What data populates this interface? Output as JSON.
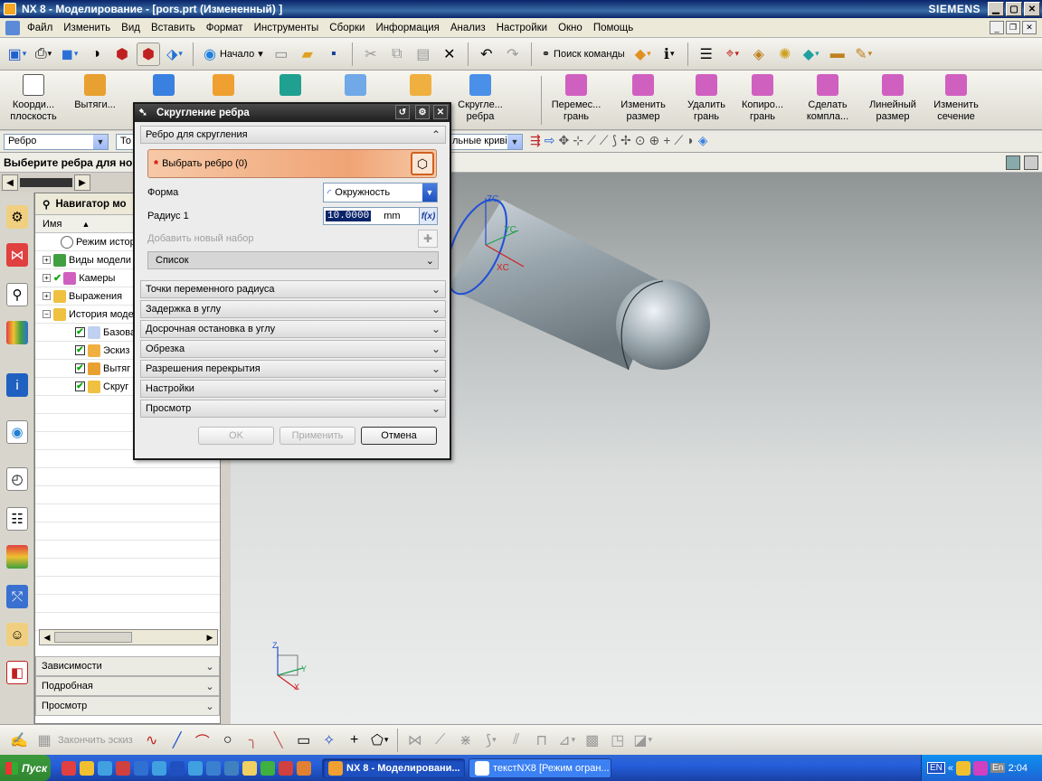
{
  "window": {
    "title": "NX 8 - Моделирование - [pors.prt (Измененный) ]",
    "brand": "SIEMENS"
  },
  "menu": [
    "Файл",
    "Изменить",
    "Вид",
    "Вставить",
    "Формат",
    "Инструменты",
    "Сборки",
    "Информация",
    "Анализ",
    "Настройки",
    "Окно",
    "Помощь"
  ],
  "toolbar1": {
    "start_label": "Начало",
    "search_label": "Поиск команды"
  },
  "toolbar2": [
    {
      "label": "Коорди... плоскость",
      "icon": "datum-plane-icon"
    },
    {
      "label": "Вытяги...",
      "icon": "extrude-icon"
    },
    {
      "label": "",
      "icon": "solid-icon"
    },
    {
      "label": "",
      "icon": "pattern-icon"
    },
    {
      "label": "",
      "icon": "feature-icon"
    },
    {
      "label": "",
      "icon": "box-icon"
    },
    {
      "label": "",
      "icon": "block-icon"
    },
    {
      "label": "Скругле... ребра",
      "icon": "edge-blend-icon"
    },
    {
      "label": "Перемес... грань",
      "icon": "move-face-icon"
    },
    {
      "label": "Изменить размер",
      "icon": "resize-icon"
    },
    {
      "label": "Удалить грань",
      "icon": "delete-face-icon"
    },
    {
      "label": "Копиро... грань",
      "icon": "copy-face-icon"
    },
    {
      "label": "Сделать компла...",
      "icon": "coplanar-icon"
    },
    {
      "label": "Линейный размер",
      "icon": "linear-dim-icon"
    },
    {
      "label": "Изменить сечение",
      "icon": "section-icon"
    }
  ],
  "toolbar3": {
    "filter_value": "Ребро",
    "scope_value": "То",
    "curve_rule": "льные криві"
  },
  "cue_line": "Выберите ребра для нов",
  "navigator": {
    "title": "Навигатор мо",
    "column_name": "Имя",
    "items": [
      {
        "label": "Режим истор",
        "level": 0
      },
      {
        "label": "Виды модели",
        "level": 0
      },
      {
        "label": "Камеры",
        "level": 0
      },
      {
        "label": "Выражения",
        "level": 0
      },
      {
        "label": "История моде",
        "level": 0
      },
      {
        "label": "Базова",
        "level": 1
      },
      {
        "label": "Эскиз",
        "level": 1
      },
      {
        "label": "Вытяг",
        "level": 1
      },
      {
        "label": "Скруг",
        "level": 1
      }
    ],
    "panels": [
      "Зависимости",
      "Подробная",
      "Просмотр"
    ]
  },
  "dialog": {
    "title": "Скругление ребра",
    "section_edges": "Ребро для скругления",
    "select_edge": "Выбрать ребро (0)",
    "shape_label": "Форма",
    "shape_value": "Окружность",
    "radius_label": "Радиус 1",
    "radius_value": "10.0000",
    "radius_unit": "mm",
    "add_set": "Добавить новый набор",
    "list": "Список",
    "sections": [
      "Точки переменного радиуса",
      "Задержка в углу",
      "Досрочная остановка в углу",
      "Обрезка",
      "Разрешения перекрытия",
      "Настройки",
      "Просмотр"
    ],
    "ok": "OK",
    "apply": "Применить",
    "cancel": "Отмена"
  },
  "viewport": {
    "zc": "ZC",
    "yc": "YC",
    "xc": "XC",
    "triad_z": "Z",
    "triad_y": "Y",
    "triad_x": "X"
  },
  "sketchbar": {
    "finish_sketch": "Закончить эскиз"
  },
  "taskbar": {
    "start": "Пуск",
    "tasks": [
      "NX 8 - Моделировани...",
      "текстNX8 [Режим огран..."
    ],
    "lang": "EN",
    "lang2": "En",
    "clock": "2:04"
  },
  "colors": {
    "accent": "#0a246a",
    "select_bar": "#f0a475",
    "viewport_top": "#8f9494",
    "viewport_bottom": "#eceeee"
  }
}
